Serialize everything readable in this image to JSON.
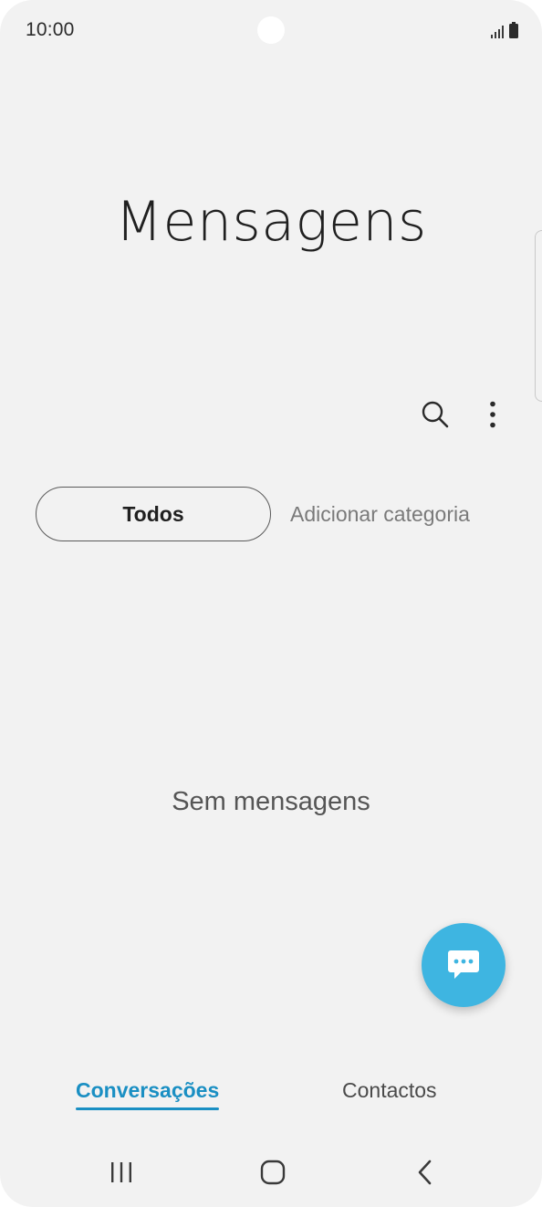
{
  "status_bar": {
    "time": "10:00",
    "signal_icon": "signal-bars-icon",
    "battery_icon": "battery-icon"
  },
  "app": {
    "title": "Mensagens"
  },
  "toolbar": {
    "search_icon": "search-icon",
    "more_icon": "more-options-icon"
  },
  "categories": {
    "all_label": "Todos",
    "add_label": "Adicionar categoria"
  },
  "empty_state": {
    "text": "Sem mensagens"
  },
  "fab": {
    "icon": "chat-bubble-icon",
    "color": "#3eb5e1"
  },
  "tabs": [
    {
      "label": "Conversações",
      "active": true
    },
    {
      "label": "Contactos",
      "active": false
    }
  ],
  "nav_bar": {
    "recents_icon": "recents-icon",
    "home_icon": "home-icon",
    "back_icon": "back-icon"
  },
  "colors": {
    "background": "#f2f2f2",
    "accent": "#1a8fc3"
  }
}
